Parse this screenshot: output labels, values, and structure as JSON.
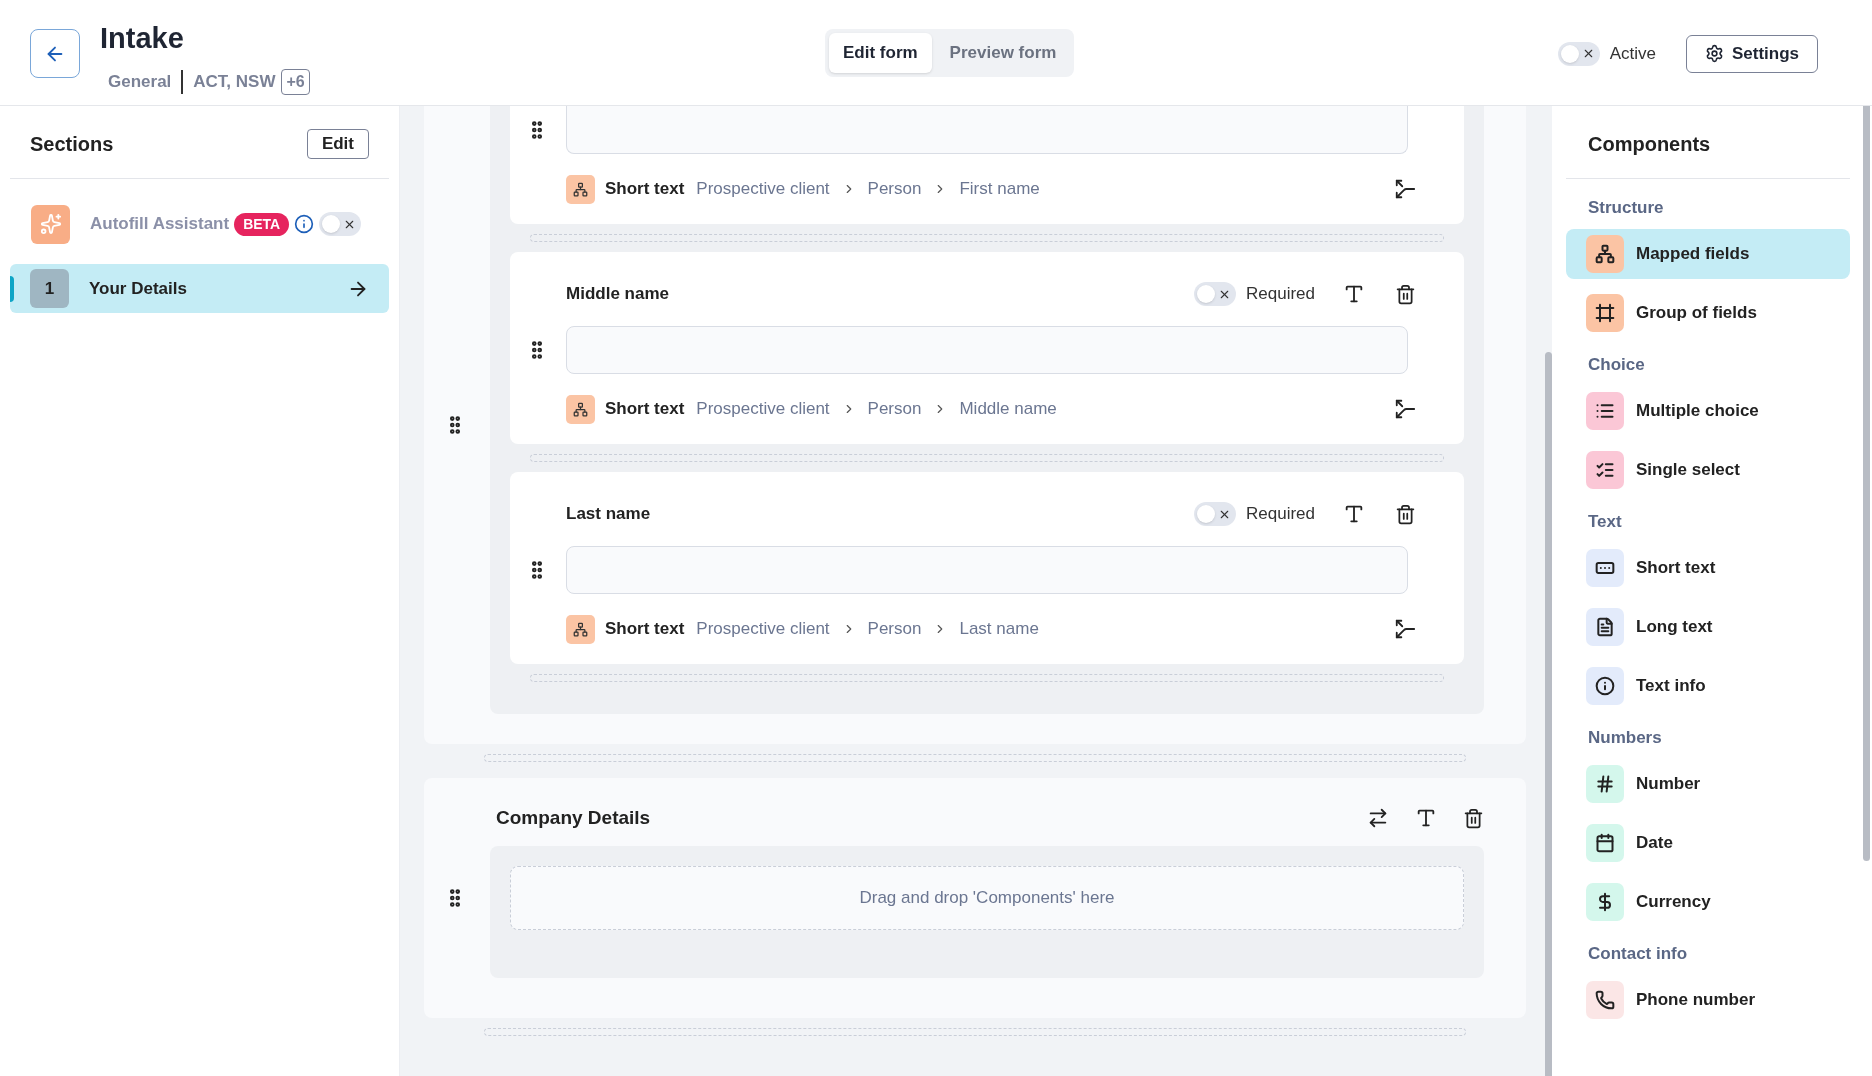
{
  "header": {
    "title": "Intake",
    "category": "General",
    "regions": "ACT, NSW",
    "more_count": "+6",
    "tabs": [
      {
        "label": "Edit form",
        "selected": true
      },
      {
        "label": "Preview form",
        "selected": false
      }
    ],
    "active_toggle": {
      "label": "Active",
      "on": false
    },
    "settings_button": "Settings"
  },
  "sidebar": {
    "title": "Sections",
    "edit_button": "Edit",
    "autofill": {
      "label": "Autofill Assistant",
      "badge": "BETA",
      "on": false
    },
    "sections": [
      {
        "number": "1",
        "label": "Your Details",
        "selected": true
      }
    ]
  },
  "canvas": {
    "sections": [
      {
        "fields": [
          {
            "type": "Short text",
            "path": [
              "Prospective client",
              "Person",
              "First name"
            ],
            "cut_top": true
          },
          {
            "label": "Middle name",
            "required_label": "Required",
            "required": false,
            "type": "Short text",
            "path": [
              "Prospective client",
              "Person",
              "Middle name"
            ]
          },
          {
            "label": "Last name",
            "required_label": "Required",
            "required": false,
            "type": "Short text",
            "path": [
              "Prospective client",
              "Person",
              "Last name"
            ]
          }
        ]
      },
      {
        "title": "Company Details",
        "drop_hint": "Drag and drop 'Components' here"
      }
    ]
  },
  "components": {
    "title": "Components",
    "groups": [
      {
        "label": "Structure",
        "color": "#fbc4a4",
        "items": [
          {
            "label": "Mapped fields",
            "kind": "mapped",
            "selected": true
          },
          {
            "label": "Group of fields",
            "kind": "group",
            "selected": false
          }
        ]
      },
      {
        "label": "Choice",
        "color": "#fbc7d6",
        "items": [
          {
            "label": "Multiple choice",
            "kind": "list",
            "selected": false
          },
          {
            "label": "Single select",
            "kind": "select",
            "selected": false
          }
        ]
      },
      {
        "label": "Text",
        "color": "#e3ebfb",
        "items": [
          {
            "label": "Short text",
            "kind": "short",
            "selected": false
          },
          {
            "label": "Long text",
            "kind": "long",
            "selected": false
          },
          {
            "label": "Text info",
            "kind": "info",
            "selected": false
          }
        ]
      },
      {
        "label": "Numbers",
        "color": "#d4f7ec",
        "items": [
          {
            "label": "Number",
            "kind": "number",
            "selected": false
          },
          {
            "label": "Date",
            "kind": "date",
            "selected": false
          },
          {
            "label": "Currency",
            "kind": "currency",
            "selected": false
          }
        ]
      },
      {
        "label": "Contact info",
        "color": "#fbe6e6",
        "items": [
          {
            "label": "Phone number",
            "kind": "phone",
            "selected": false
          }
        ]
      }
    ]
  }
}
